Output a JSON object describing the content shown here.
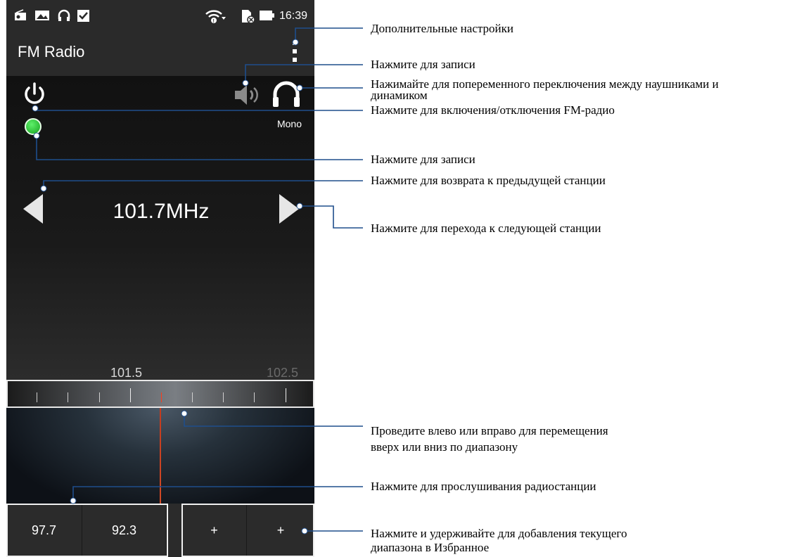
{
  "status_bar": {
    "left_icons": [
      "radio-icon",
      "image-icon",
      "headphones-icon",
      "checkbox-icon"
    ],
    "right_icons": [
      "wifi-icon",
      "sd-card-icon",
      "battery-icon"
    ],
    "time": "16:39"
  },
  "app_bar": {
    "title": "FM Radio",
    "menu_icon": "overflow-menu-icon"
  },
  "player": {
    "frequency": "101.7MHz",
    "audio_mode": "Mono",
    "power_icon": "power-icon",
    "record_icon": "record-dot-icon",
    "speaker_icon": "speaker-icon",
    "headset_icon": "headphones-icon"
  },
  "tuner": {
    "left_label": "101.5",
    "right_label": "102.5"
  },
  "presets": [
    {
      "label": "97.7"
    },
    {
      "label": "92.3"
    },
    {
      "label": "+"
    },
    {
      "label": "+"
    }
  ],
  "callouts": {
    "more_settings": "Дополнительные настройки",
    "record_top": "Нажмите для записи",
    "toggle_headset_1": "Нажимайте для попеременного переключения между наушниками и",
    "toggle_headset_2": "динамиком",
    "power": "Нажмите для включения/отключения FM-радио",
    "record": "Нажмите для записи",
    "prev": "Нажмите для возврата к предыдущей станции",
    "next": "Нажмите для перехода к следующей станции",
    "swipe_1": "Проведите влево или вправо для перемещения",
    "swipe_2": "вверх или вниз по диапазону",
    "listen": "Нажмите для прослушивания радиостанции",
    "add_fav_1": "Нажмите и удерживайте для добавления текущего",
    "add_fav_2": "диапазона в Избранное"
  },
  "colors": {
    "status_bar_bg": "#2a2a2a",
    "record_green": "#22c02c",
    "needle_red": "#d24a26",
    "callout_line": "#1f4e8c"
  }
}
